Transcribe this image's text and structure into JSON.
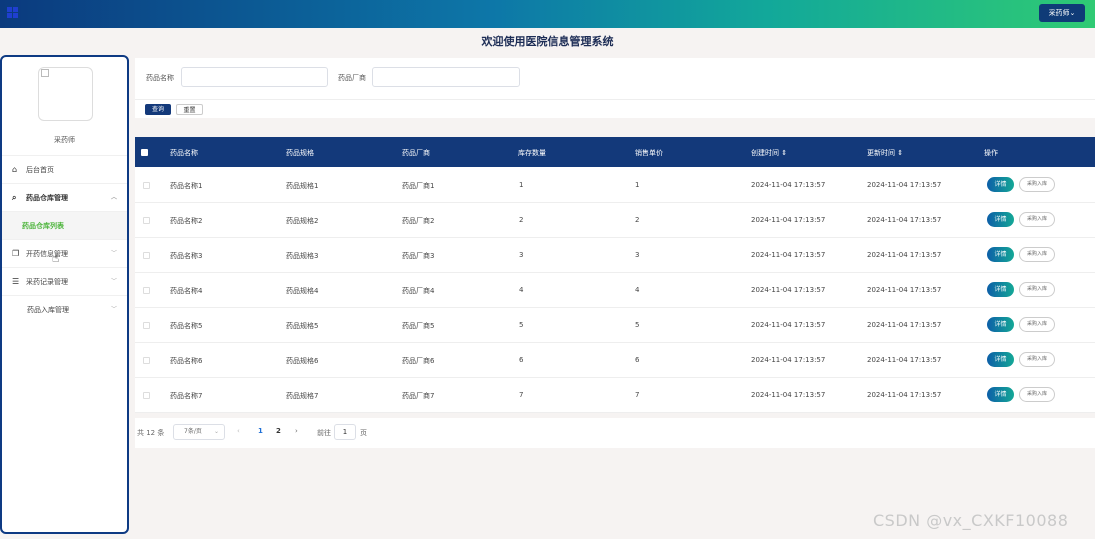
{
  "header": {
    "user_menu": "采药师⌄"
  },
  "page_title": "欢迎使用医院信息管理系统",
  "sidebar": {
    "user_name": "采药师",
    "items": [
      {
        "label": "后台首页",
        "icon": "home-icon",
        "expandable": false
      },
      {
        "label": "药品仓库管理",
        "icon": "paperclip-icon",
        "expandable": true,
        "expanded": true
      },
      {
        "label": "药品仓库列表",
        "icon": "",
        "submenu": true,
        "active": true
      },
      {
        "label": "开药信息管理",
        "icon": "copy-icon",
        "expandable": true
      },
      {
        "label": "采药记录管理",
        "icon": "sliders-icon",
        "expandable": true
      },
      {
        "label": "药品入库管理",
        "icon": "",
        "expandable": true
      }
    ]
  },
  "search": {
    "name_label": "药品名称",
    "manufacturer_label": "药品厂商",
    "query_button": "查询",
    "reset_button": "重置"
  },
  "table": {
    "headers": [
      "药品名称",
      "药品规格",
      "药品厂商",
      "库存数量",
      "销售单价",
      "创建时间 ⇕",
      "更新时间 ⇕",
      "操作"
    ],
    "detail_label": "详情",
    "stock_label": "采购入库",
    "rows": [
      [
        "药品名称1",
        "药品规格1",
        "药品厂商1",
        "1",
        "1",
        "2024-11-04 17:13:57",
        "2024-11-04 17:13:57"
      ],
      [
        "药品名称2",
        "药品规格2",
        "药品厂商2",
        "2",
        "2",
        "2024-11-04 17:13:57",
        "2024-11-04 17:13:57"
      ],
      [
        "药品名称3",
        "药品规格3",
        "药品厂商3",
        "3",
        "3",
        "2024-11-04 17:13:57",
        "2024-11-04 17:13:57"
      ],
      [
        "药品名称4",
        "药品规格4",
        "药品厂商4",
        "4",
        "4",
        "2024-11-04 17:13:57",
        "2024-11-04 17:13:57"
      ],
      [
        "药品名称5",
        "药品规格5",
        "药品厂商5",
        "5",
        "5",
        "2024-11-04 17:13:57",
        "2024-11-04 17:13:57"
      ],
      [
        "药品名称6",
        "药品规格6",
        "药品厂商6",
        "6",
        "6",
        "2024-11-04 17:13:57",
        "2024-11-04 17:13:57"
      ],
      [
        "药品名称7",
        "药品规格7",
        "药品厂商7",
        "7",
        "7",
        "2024-11-04 17:13:57",
        "2024-11-04 17:13:57"
      ]
    ]
  },
  "pagination": {
    "total": "共 12 条",
    "page_size": "7条/页",
    "prev": "‹",
    "pages": [
      "1",
      "2"
    ],
    "current_page": "2",
    "next": "›",
    "goto_label": "前往",
    "goto_value": "1",
    "page_suffix": "页"
  },
  "watermark": "CSDN @vx_CXKF10088",
  "colors": {
    "primary": "#13397a",
    "active_menu": "#4db53c"
  }
}
